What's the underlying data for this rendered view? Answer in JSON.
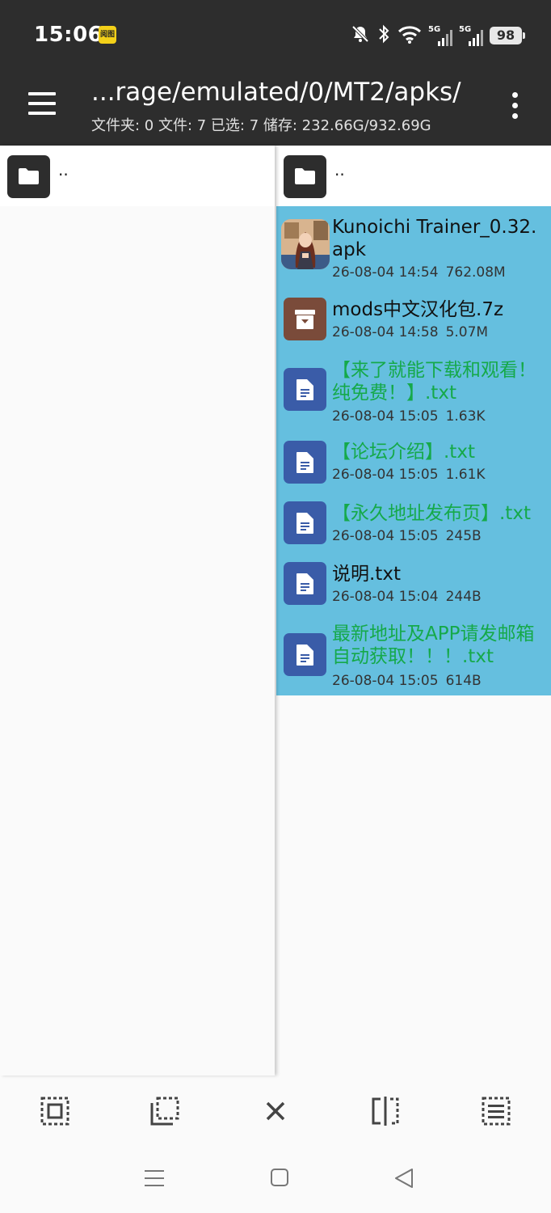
{
  "status_bar": {
    "time": "15:06",
    "app_badge": "阅图",
    "network_left": "5G",
    "network_right": "5G",
    "battery": "98"
  },
  "toolbar": {
    "path": "...rage/emulated/0/MT2/apks/",
    "stats": "文件夹: 0  文件: 7  已选: 7  储存: 232.66G/932.69G"
  },
  "left_pane": {
    "parent_label": ".."
  },
  "right_pane": {
    "parent_label": "..",
    "selection_color": "#65bfdf",
    "files": [
      {
        "name": "Kunoichi Trainer_0.32.apk",
        "date": "26-08-04 14:54",
        "size": "762.08M",
        "type": "apk",
        "highlight": false
      },
      {
        "name": "mods中文汉化包.7z",
        "date": "26-08-04 14:58",
        "size": "5.07M",
        "type": "archive",
        "highlight": false
      },
      {
        "name": "【来了就能下载和观看！纯免费！】.txt",
        "date": "26-08-04 15:05",
        "size": "1.63K",
        "type": "txt",
        "highlight": true
      },
      {
        "name": "【论坛介绍】.txt",
        "date": "26-08-04 15:05",
        "size": "1.61K",
        "type": "txt",
        "highlight": true
      },
      {
        "name": "【永久地址发布页】.txt",
        "date": "26-08-04 15:05",
        "size": "245B",
        "type": "txt",
        "highlight": true
      },
      {
        "name": "说明.txt",
        "date": "26-08-04 15:04",
        "size": "244B",
        "type": "txt",
        "highlight": false
      },
      {
        "name": "最新地址及APP请发邮箱自动获取！！！.txt",
        "date": "26-08-04 15:05",
        "size": "614B",
        "type": "txt",
        "highlight": true
      }
    ]
  },
  "bottom_actions": [
    "select-all-icon",
    "select-range-icon",
    "close-icon",
    "split-pane-icon",
    "list-view-icon"
  ],
  "nav_bar": [
    "recents-icon",
    "home-icon",
    "back-icon"
  ]
}
